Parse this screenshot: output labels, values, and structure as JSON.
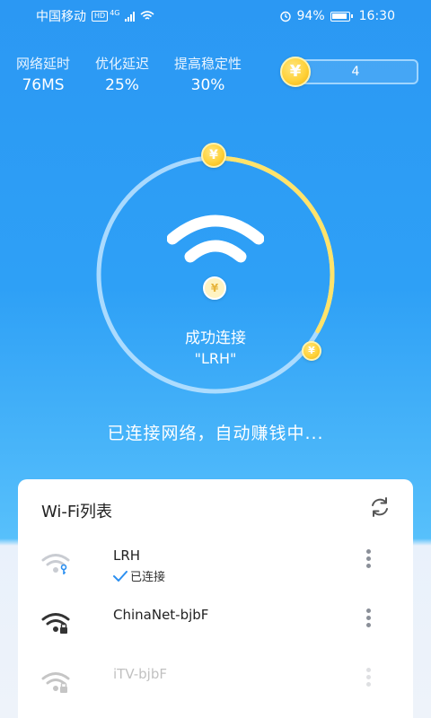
{
  "status_bar": {
    "carrier": "中国移动",
    "network_badge": "HD",
    "network_type": "4G",
    "battery": "94%",
    "time": "16:30"
  },
  "stats": [
    {
      "label": "网络延时",
      "value": "76MS"
    },
    {
      "label": "优化延迟",
      "value": "25%"
    },
    {
      "label": "提高稳定性",
      "value": "30%"
    }
  ],
  "coins": {
    "count": "4",
    "symbol": "¥"
  },
  "ring": {
    "progress_fraction": 0.33,
    "track_color": "#bfe4ff",
    "progress_color": "#ffe36b"
  },
  "connection": {
    "status": "成功连接",
    "ssid": "\"LRH\""
  },
  "earning_text": "已连接网络，自动赚钱中...",
  "wifi_list": {
    "title": "Wi-Fi列表",
    "refresh_icon": "refresh-icon",
    "networks": [
      {
        "name": "LRH",
        "status": "已连接",
        "icon": "wifi-key-icon"
      },
      {
        "name": "ChinaNet-bjbF",
        "status": "",
        "icon": "wifi-lock-icon"
      },
      {
        "name": "iTV-bjbF",
        "status": "",
        "icon": "wifi-lock-icon"
      }
    ]
  },
  "colors": {
    "accent": "#2ea0f6",
    "coin": "#ffd23a",
    "check": "#2b8ff0"
  }
}
